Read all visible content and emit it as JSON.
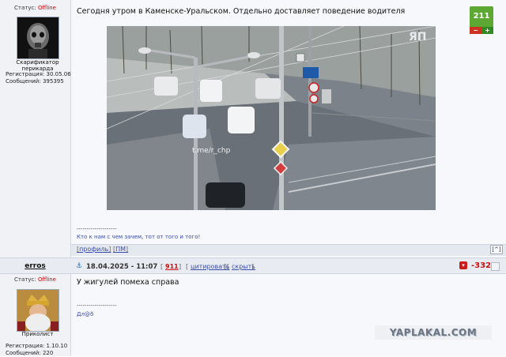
{
  "post1": {
    "user": {
      "status_label": "Статус:",
      "status_value": "Offline",
      "title": "Скарификатор перикарда",
      "reg_label": "Регистрация:",
      "reg_value": "30.05.06",
      "msgs_label": "Сообщений:",
      "msgs_value": "395395"
    },
    "text": "Сегодня утром в Каменске-Уральском. Отдельно доставляет поведение водителя",
    "video": {
      "watermark_text": "t.me/r_chp",
      "channel_logo": "ЯП"
    },
    "rating": {
      "value": "211",
      "minus": "−",
      "plus": "+"
    },
    "signature": {
      "divider": "--------------------",
      "text": "Кто к нам с чем зачем, тот от того и того!"
    },
    "bottom_bar": {
      "profile_link": "профиль",
      "pm_link": "ПМ",
      "up_label": "[^]"
    }
  },
  "post2": {
    "user": {
      "name": "erros",
      "status_label": "Статус:",
      "status_value": "Offline",
      "title": "Приколист",
      "reg_label": "Регистрация:",
      "reg_value": "1.10.10",
      "msgs_label": "Сообщений:",
      "msgs_value": "220"
    },
    "date": "18.04.2025 - 11:07",
    "post_number": "911",
    "quote_link": "цитировать",
    "hide_link": "скрыть",
    "rating": "-332",
    "text": "У жигулей помеха справа",
    "signature": {
      "divider": "--------------------",
      "text": "Дл@ð"
    }
  },
  "site_watermark": "YAPLAKAL.COM",
  "colors": {
    "rating_positive": "#5da832",
    "rating_negative": "#cc1111",
    "link": "#3a4dad",
    "status_offline": "#cc0000"
  }
}
